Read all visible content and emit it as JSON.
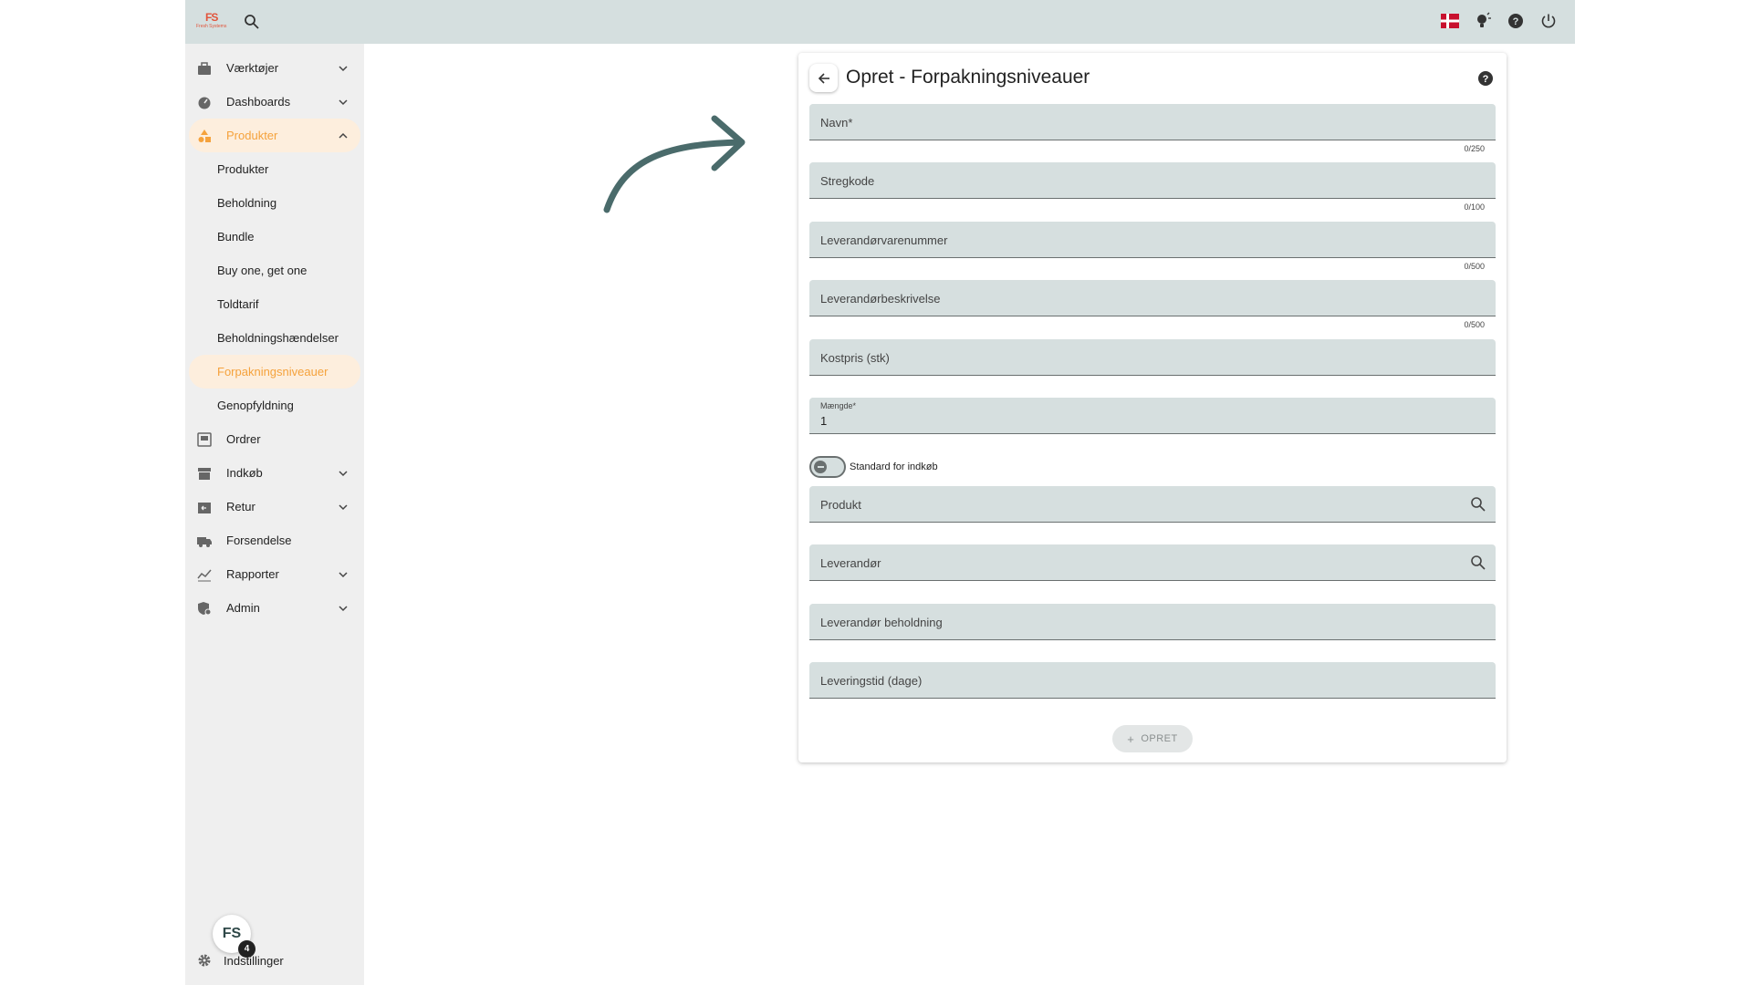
{
  "topbar": {
    "logo_text": "FS",
    "logo_sub": "Fresh Systems",
    "icons": [
      "search-icon",
      "danish-flag-icon",
      "lightbulb-icon",
      "help-icon",
      "power-icon"
    ]
  },
  "sidebar": {
    "items": [
      {
        "label": "Værktøjer",
        "icon": "toolbox-icon",
        "chevron": "down"
      },
      {
        "label": "Dashboards",
        "icon": "speedometer-icon",
        "chevron": "down"
      },
      {
        "label": "Produkter",
        "icon": "shapes-icon",
        "chevron": "up",
        "active": true
      }
    ],
    "sub_items": [
      {
        "label": "Produkter"
      },
      {
        "label": "Beholdning"
      },
      {
        "label": "Bundle"
      },
      {
        "label": "Buy one, get one"
      },
      {
        "label": "Toldtarif"
      },
      {
        "label": "Beholdningshændelser"
      },
      {
        "label": "Forpakningsniveauer",
        "active": true
      },
      {
        "label": "Genopfyldning"
      }
    ],
    "items_after": [
      {
        "label": "Ordrer",
        "icon": "inbox-icon"
      },
      {
        "label": "Indkøb",
        "icon": "store-icon",
        "chevron": "down"
      },
      {
        "label": "Retur",
        "icon": "return-box-icon",
        "chevron": "down"
      },
      {
        "label": "Forsendelse",
        "icon": "truck-icon"
      },
      {
        "label": "Rapporter",
        "icon": "chart-icon",
        "chevron": "down"
      },
      {
        "label": "Admin",
        "icon": "admin-icon",
        "chevron": "down"
      }
    ],
    "settings_label": "Indstillinger",
    "fab_label": "FS",
    "fab_badge": "4"
  },
  "form": {
    "title": "Opret - Forpakningsniveauer",
    "fields": {
      "navn": {
        "label": "Navn*",
        "counter": "0/250"
      },
      "stregkode": {
        "label": "Stregkode",
        "counter": "0/100"
      },
      "leverandoervarenummer": {
        "label": "Leverandørvarenummer",
        "counter": "0/500"
      },
      "leverandoerbeskrivelse": {
        "label": "Leverandørbeskrivelse",
        "counter": "0/500"
      },
      "kostpris": {
        "label": "Kostpris (stk)"
      },
      "maengde": {
        "label": "Mængde*",
        "value": "1"
      },
      "produkt": {
        "label": "Produkt"
      },
      "leverandoer": {
        "label": "Leverandør"
      },
      "leverandoer_beholdning": {
        "label": "Leverandør beholdning"
      },
      "leveringstid": {
        "label": "Leveringstid (dage)"
      }
    },
    "toggle_label": "Standard for indkøb",
    "toggle_on": false,
    "create_button": "OPRET"
  },
  "colors": {
    "topbar": "#d5dfdf",
    "sidebar": "#efefef",
    "accent": "#f5a23c",
    "field_bg": "#d6dfdf",
    "arrow": "#4a6b6b"
  }
}
